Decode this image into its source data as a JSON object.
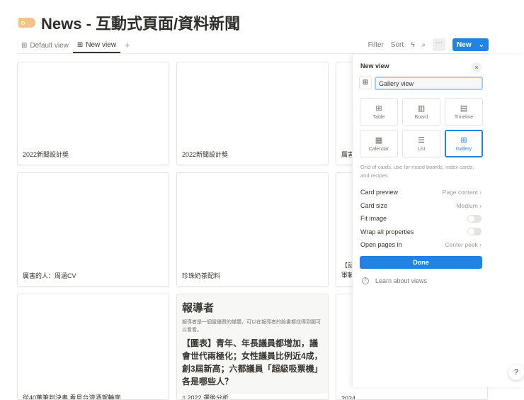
{
  "page": {
    "title": "News - 互動式頁面/資料新聞"
  },
  "tabs": [
    {
      "label": "Default view",
      "icon": "table-icon"
    },
    {
      "label": "New view",
      "icon": "gallery-icon"
    }
  ],
  "toolbar": {
    "filter": "Filter",
    "sort": "Sort",
    "more": "···",
    "new": "New"
  },
  "cards": [
    {
      "caption": "2022新聞設計獎"
    },
    {
      "caption": "2022新聞設計獎"
    },
    {
      "caption": "厲害"
    },
    {
      "caption": "厲害的人：周涵CV"
    },
    {
      "caption": "珍珠奶茶配料"
    },
    {
      "caption": "【記\n軍輔"
    },
    {
      "caption": "從40萬筆判決書 看見台灣酒駕輪廓"
    },
    {
      "preview_title": "報導者",
      "preview_text": "報導者是一個蠻優質的媒體，可以在報導者的臉書都找得到圖可以看看。",
      "preview_heading": "【圖表】青年、年長議員都增加，議會世代兩極化；女性議員比例近4成，創3屆新高；六都議員「超級吸票機」各是哪些人？",
      "caption": "2022 選後分析"
    },
    {
      "caption": "2024"
    }
  ],
  "panel": {
    "title": "New view",
    "name_value": "Gallery view",
    "types": [
      {
        "label": "Table",
        "icon": "⊞"
      },
      {
        "label": "Board",
        "icon": "▥"
      },
      {
        "label": "Timeline",
        "icon": "▤"
      },
      {
        "label": "Calendar",
        "icon": "▦"
      },
      {
        "label": "List",
        "icon": "☰"
      },
      {
        "label": "Gallery",
        "icon": "⊞"
      }
    ],
    "description": "Grid of cards, use for mood boards, index cards, and recipes",
    "settings": [
      {
        "label": "Card preview",
        "value": "Page content"
      },
      {
        "label": "Card size",
        "value": "Medium"
      },
      {
        "label": "Fit image",
        "toggle": false
      },
      {
        "label": "Wrap all properties",
        "toggle": false
      },
      {
        "label": "Open pages in",
        "value": "Center peek"
      }
    ],
    "done": "Done",
    "learn": "Learn about views"
  },
  "help": "?"
}
